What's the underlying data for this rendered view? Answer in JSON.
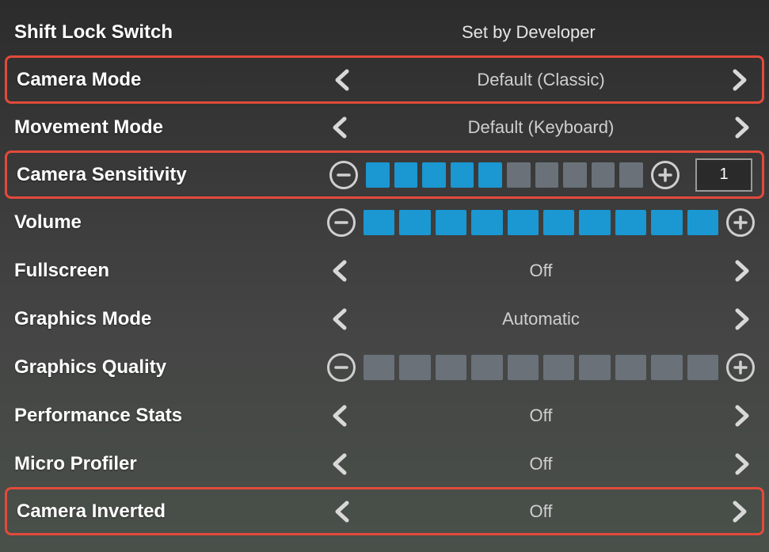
{
  "rows": [
    {
      "key": "shift-lock",
      "label": "Shift Lock Switch",
      "type": "static",
      "value": "Set by Developer",
      "highlighted": false
    },
    {
      "key": "camera-mode",
      "label": "Camera Mode",
      "type": "selector",
      "value": "Default (Classic)",
      "highlighted": true
    },
    {
      "key": "movement-mode",
      "label": "Movement Mode",
      "type": "selector",
      "value": "Default (Keyboard)",
      "highlighted": false
    },
    {
      "key": "camera-sensitivity",
      "label": "Camera Sensitivity",
      "type": "stepper",
      "segments": 10,
      "filled": 5,
      "numeric": "1",
      "highlighted": true
    },
    {
      "key": "volume",
      "label": "Volume",
      "type": "stepper",
      "segments": 10,
      "filled": 10,
      "numeric": null,
      "highlighted": false
    },
    {
      "key": "fullscreen",
      "label": "Fullscreen",
      "type": "selector",
      "value": "Off",
      "highlighted": false
    },
    {
      "key": "graphics-mode",
      "label": "Graphics Mode",
      "type": "selector",
      "value": "Automatic",
      "highlighted": false
    },
    {
      "key": "graphics-quality",
      "label": "Graphics Quality",
      "type": "stepper",
      "segments": 10,
      "filled": 0,
      "numeric": null,
      "highlighted": false
    },
    {
      "key": "performance-stats",
      "label": "Performance Stats",
      "type": "selector",
      "value": "Off",
      "highlighted": false
    },
    {
      "key": "micro-profiler",
      "label": "Micro Profiler",
      "type": "selector",
      "value": "Off",
      "highlighted": false
    },
    {
      "key": "camera-inverted",
      "label": "Camera Inverted",
      "type": "selector",
      "value": "Off",
      "highlighted": true
    }
  ],
  "colors": {
    "highlight": "#e24a3b",
    "barFilled": "#1b97d1",
    "barEmpty": "#6a7179"
  }
}
